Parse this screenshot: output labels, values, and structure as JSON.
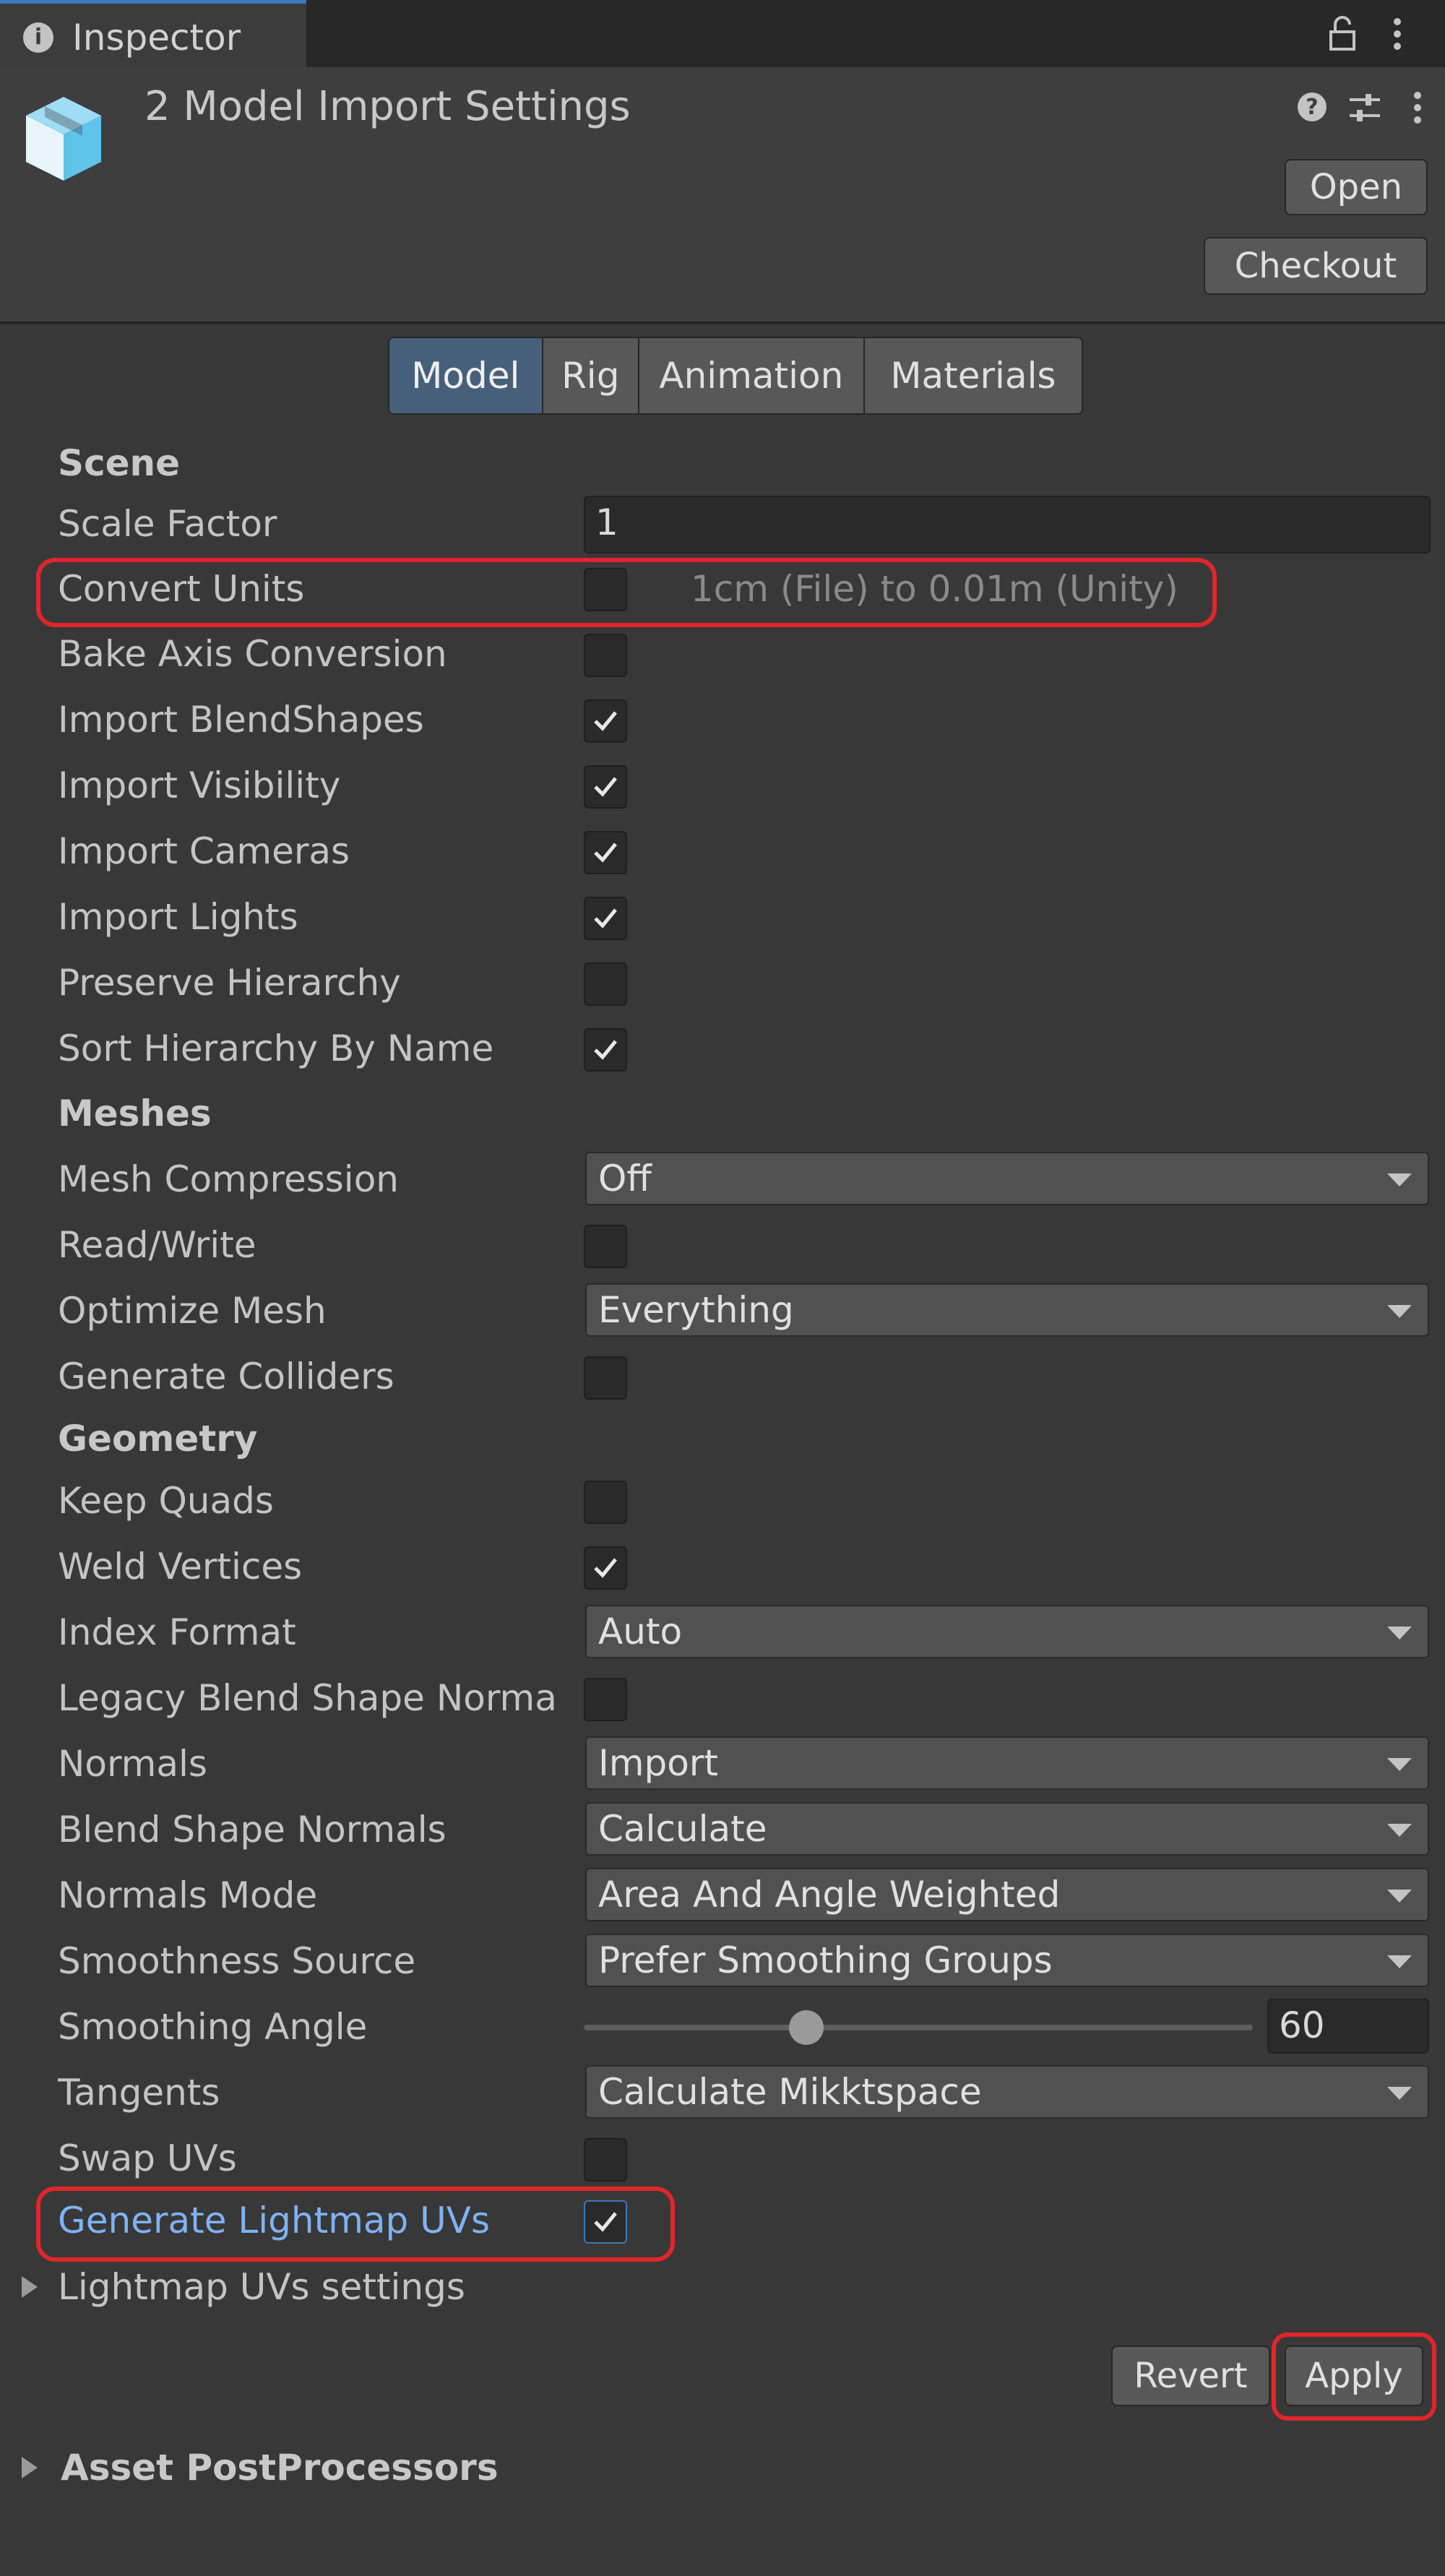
{
  "window": {
    "tab_label": "Inspector"
  },
  "header": {
    "title": "2 Model Import Settings",
    "open_label": "Open",
    "checkout_label": "Checkout"
  },
  "subtabs": [
    {
      "label": "Model",
      "active": true
    },
    {
      "label": "Rig"
    },
    {
      "label": "Animation"
    },
    {
      "label": "Materials"
    }
  ],
  "scene": {
    "title": "Scene",
    "scale_factor": {
      "label": "Scale Factor",
      "value": "1"
    },
    "convert_units": {
      "label": "Convert Units",
      "checked": false,
      "hint": "1cm (File) to 0.01m (Unity)"
    },
    "bake_axis": {
      "label": "Bake Axis Conversion",
      "checked": false
    },
    "import_blendshapes": {
      "label": "Import BlendShapes",
      "checked": true
    },
    "import_visibility": {
      "label": "Import Visibility",
      "checked": true
    },
    "import_cameras": {
      "label": "Import Cameras",
      "checked": true
    },
    "import_lights": {
      "label": "Import Lights",
      "checked": true
    },
    "preserve_hierarchy": {
      "label": "Preserve Hierarchy",
      "checked": false
    },
    "sort_hierarchy": {
      "label": "Sort Hierarchy By Name",
      "checked": true
    }
  },
  "meshes": {
    "title": "Meshes",
    "mesh_compression": {
      "label": "Mesh Compression",
      "value": "Off"
    },
    "read_write": {
      "label": "Read/Write",
      "checked": false
    },
    "optimize_mesh": {
      "label": "Optimize Mesh",
      "value": "Everything"
    },
    "generate_colliders": {
      "label": "Generate Colliders",
      "checked": false
    }
  },
  "geometry": {
    "title": "Geometry",
    "keep_quads": {
      "label": "Keep Quads",
      "checked": false
    },
    "weld_vertices": {
      "label": "Weld Vertices",
      "checked": true
    },
    "index_format": {
      "label": "Index Format",
      "value": "Auto"
    },
    "legacy_blend": {
      "label": "Legacy Blend Shape Norma",
      "checked": false
    },
    "normals": {
      "label": "Normals",
      "value": "Import"
    },
    "blend_shape_normals": {
      "label": "Blend Shape Normals",
      "value": "Calculate"
    },
    "normals_mode": {
      "label": "Normals Mode",
      "value": "Area And Angle Weighted"
    },
    "smoothness_source": {
      "label": "Smoothness Source",
      "value": "Prefer Smoothing Groups"
    },
    "smoothing_angle": {
      "label": "Smoothing Angle",
      "value": "60",
      "slider_fraction": 0.333
    },
    "tangents": {
      "label": "Tangents",
      "value": "Calculate Mikktspace"
    },
    "swap_uvs": {
      "label": "Swap UVs",
      "checked": false
    },
    "generate_lightmap_uvs": {
      "label": "Generate Lightmap UVs",
      "checked": true
    },
    "lightmap_settings": {
      "label": "Lightmap UVs settings"
    }
  },
  "footer": {
    "revert_label": "Revert",
    "apply_label": "Apply",
    "asset_postprocessors": "Asset PostProcessors"
  },
  "colors": {
    "highlight": "#e0252b",
    "active_tab": "#46607c",
    "link_text": "#7fb2f5"
  }
}
